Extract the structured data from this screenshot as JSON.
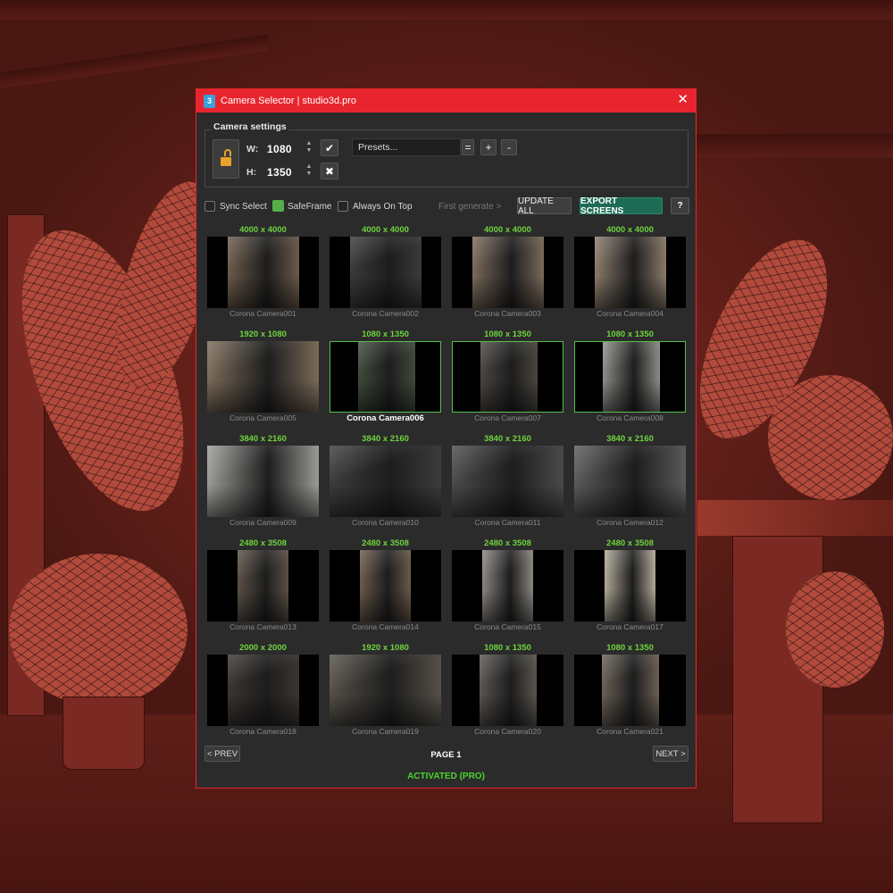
{
  "window": {
    "title": "Camera Selector | studio3d.pro",
    "app_icon_text": "3",
    "close_glyph": "✕"
  },
  "settings": {
    "legend": "Camera settings",
    "w_label": "W:",
    "w_value": "1080",
    "h_label": "H:",
    "h_value": "1350",
    "confirm_glyph": "✔",
    "cancel_glyph": "✖",
    "presets_value": "Presets...",
    "preset_equals": "=",
    "preset_add": "+",
    "preset_remove": "-",
    "lock_state": "unlocked"
  },
  "options": {
    "sync_select": {
      "label": "Sync Select",
      "checked": false
    },
    "safeframe": {
      "label": "SafeFrame",
      "checked": true
    },
    "always_on_top": {
      "label": "Always On Top",
      "checked": false
    },
    "first_generate": "First generate >",
    "update_all": "UPDATE ALL",
    "export_screens": "EXPORT SCREENS",
    "help": "?"
  },
  "cameras": [
    {
      "res": "4000 x 4000",
      "name": "Corona Camera001",
      "aspect": "square",
      "tone": "#6b5a4a"
    },
    {
      "res": "4000 x 4000",
      "name": "Corona Camera002",
      "aspect": "square",
      "tone": "#3a3a3a"
    },
    {
      "res": "4000 x 4000",
      "name": "Corona Camera003",
      "aspect": "square",
      "tone": "#7a6a5a"
    },
    {
      "res": "4000 x 4000",
      "name": "Corona Camera004",
      "aspect": "square",
      "tone": "#8a7a6a"
    },
    {
      "res": "1920 x 1080",
      "name": "Corona Camera005",
      "aspect": "wide",
      "tone": "#7a6a58"
    },
    {
      "res": "1080 x 1350",
      "name": "Corona Camera006",
      "aspect": "portrait",
      "tone": "#3f4a3a",
      "selected": true,
      "active": true
    },
    {
      "res": "1080 x 1350",
      "name": "Corona Camera007",
      "aspect": "portrait",
      "tone": "#4a4540",
      "selected": true
    },
    {
      "res": "1080 x 1350",
      "name": "Corona Camera008",
      "aspect": "portrait",
      "tone": "#8c8c88",
      "selected": true
    },
    {
      "res": "3840 x 2160",
      "name": "Corona Camera009",
      "aspect": "wide",
      "tone": "#9a9a96"
    },
    {
      "res": "3840 x 2160",
      "name": "Corona Camera010",
      "aspect": "wide",
      "tone": "#3c3c3c"
    },
    {
      "res": "3840 x 2160",
      "name": "Corona Camera011",
      "aspect": "wide",
      "tone": "#4a4a4a"
    },
    {
      "res": "3840 x 2160",
      "name": "Corona Camera012",
      "aspect": "wide",
      "tone": "#5a5a5a"
    },
    {
      "res": "2480 x 3508",
      "name": "Corona Camera013",
      "aspect": "a4",
      "tone": "#5a5045"
    },
    {
      "res": "2480 x 3508",
      "name": "Corona Camera014",
      "aspect": "a4",
      "tone": "#6a5a4a"
    },
    {
      "res": "2480 x 3508",
      "name": "Corona Camera015",
      "aspect": "a4",
      "tone": "#8a8580"
    },
    {
      "res": "2480 x 3508",
      "name": "Corona Camera017",
      "aspect": "a4",
      "tone": "#b0a898"
    },
    {
      "res": "2000 x 2000",
      "name": "Corona Camera018",
      "aspect": "square",
      "tone": "#3a3530"
    },
    {
      "res": "1920 x 1080",
      "name": "Corona Camera019",
      "aspect": "wide",
      "tone": "#555048"
    },
    {
      "res": "1080 x 1350",
      "name": "Corona Camera020",
      "aspect": "portrait",
      "tone": "#5a5550"
    },
    {
      "res": "1080 x 1350",
      "name": "Corona Camera021",
      "aspect": "portrait",
      "tone": "#6a6055"
    }
  ],
  "pagination": {
    "prev": "< PREV",
    "page": "PAGE 1",
    "next": "NEXT >"
  },
  "status": "ACTIVATED (PRO)",
  "colors": {
    "accent": "#e8252e",
    "resolution_text": "#6fd33e",
    "selection_border": "#55c048",
    "export_button": "#1e6b55",
    "activated_text": "#4bd32e"
  }
}
